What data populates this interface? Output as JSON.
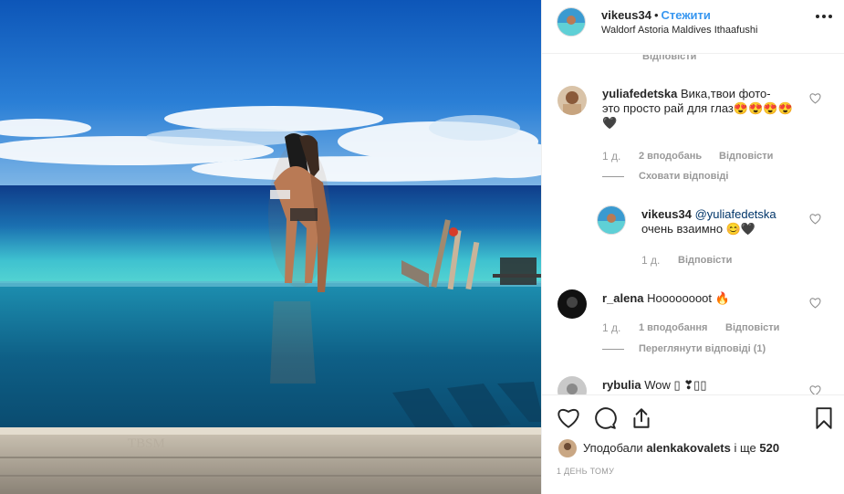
{
  "post": {
    "username": "vikeus34",
    "separator": "•",
    "follow_label": "Стежити",
    "location": "Waldorf Astoria Maldives Ithaafushi"
  },
  "comments": {
    "top_cut_reply_label": "Відповісти",
    "items": [
      {
        "username": "yuliafedetska",
        "text_line1": "Вика,твои фото-",
        "text_line2": "это просто рай для глаз😍😍😍😍",
        "text_line3": "🖤",
        "age": "1 д.",
        "likes": "2 вподобань",
        "reply_label": "Відповісти",
        "replies_toggle": "Сховати відповіді"
      },
      {
        "username": "vikeus34",
        "mention": "@yuliafedetska",
        "text_line2": "очень взаимно 😊🖤",
        "age": "1 д.",
        "reply_label": "Відповісти"
      },
      {
        "username": "r_alena",
        "text": "Hoooooooot 🔥",
        "age": "1 д.",
        "likes": "1 вподобання",
        "reply_label": "Відповісти",
        "replies_toggle": "Переглянути відповіді (1)"
      },
      {
        "username": "rybulia",
        "text": "Wow ▯ ❣▯▯"
      }
    ]
  },
  "likes": {
    "prefix": "Уподобали",
    "user": "alenkakovalets",
    "middle": "і ще",
    "count": "520"
  },
  "time_ago": "1 ДЕНЬ ТОМУ",
  "icons": [
    "like-heart-icon",
    "comment-icon",
    "share-icon",
    "bookmark-icon",
    "more-options-icon"
  ],
  "colors": {
    "link": "#3897f0",
    "meta": "#999999",
    "text": "#262626",
    "divider": "#efefef"
  }
}
